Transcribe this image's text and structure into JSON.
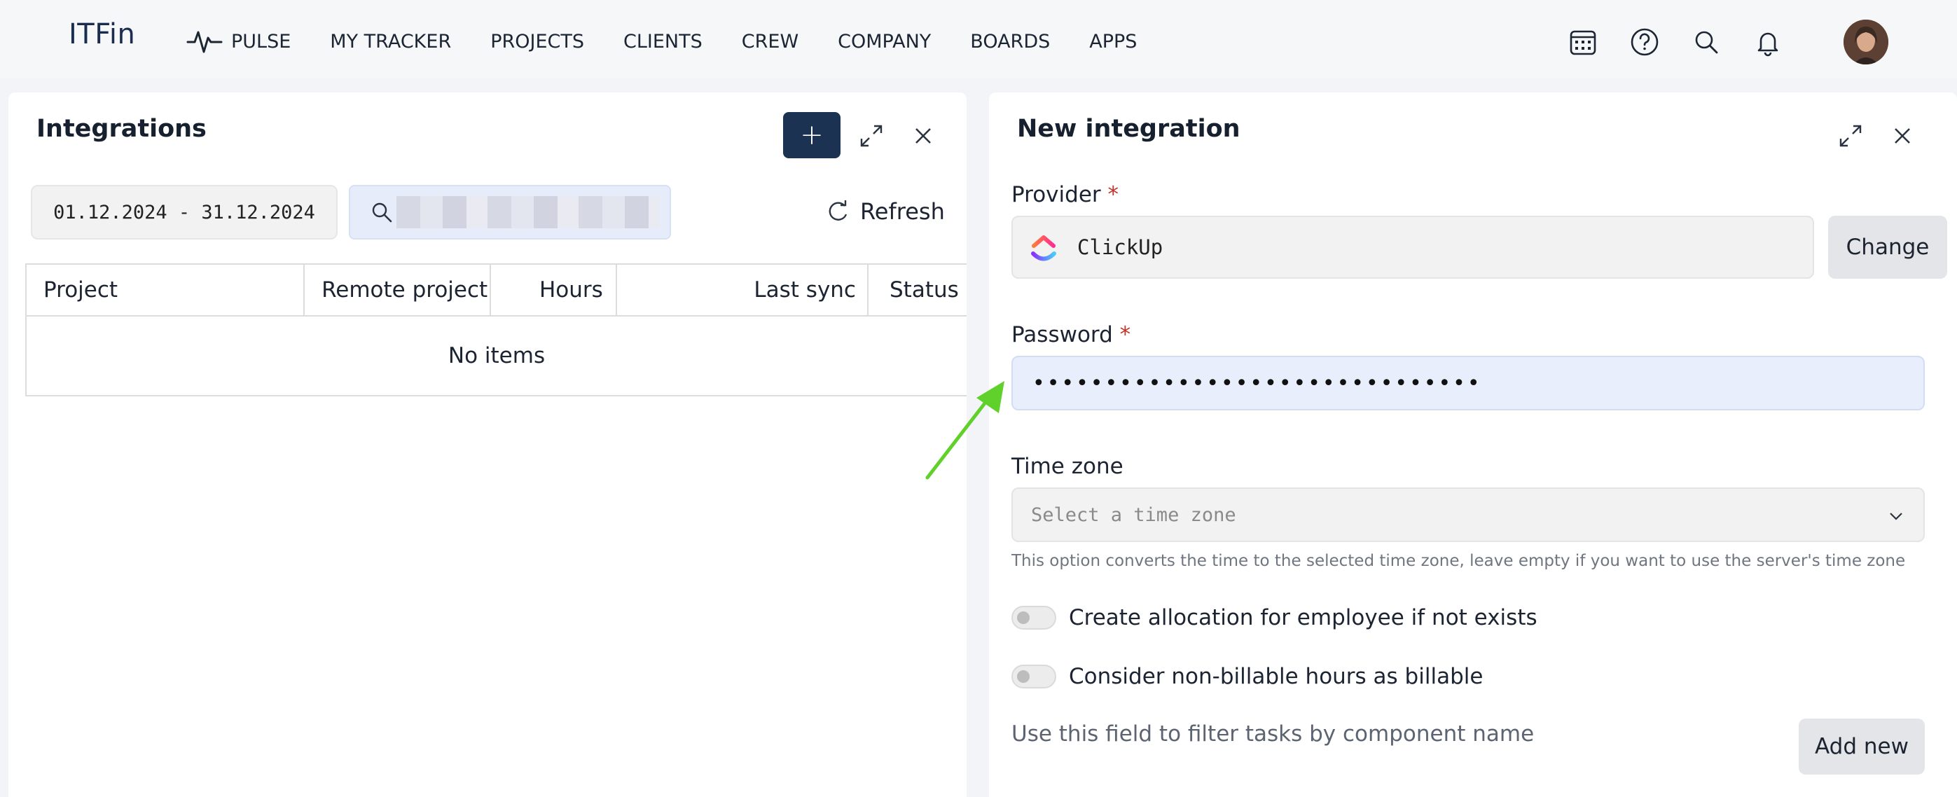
{
  "brand": {
    "logo": "ITFin"
  },
  "nav": {
    "items": [
      "PULSE",
      "MY TRACKER",
      "PROJECTS",
      "CLIENTS",
      "CREW",
      "COMPANY",
      "BOARDS",
      "APPS"
    ],
    "icons": [
      "calendar-icon",
      "help-icon",
      "search-icon",
      "bell-icon"
    ]
  },
  "integrations": {
    "title": "Integrations",
    "add_label": "+",
    "date_range": "01.12.2024 - 31.12.2024",
    "refresh_label": "Refresh",
    "columns": [
      "Project",
      "Remote project",
      "Hours",
      "Last sync",
      "Status"
    ],
    "empty_text": "No items"
  },
  "new_integration": {
    "title": "New integration",
    "provider_label": "Provider",
    "provider_value": "ClickUp",
    "change_label": "Change",
    "password_label": "Password",
    "password_value": "•••••••••••••••••••••••••••••••",
    "timezone_label": "Time zone",
    "timezone_placeholder": "Select a time zone",
    "timezone_hint": "This option converts the time to the selected time zone, leave empty if you want to use the server's time zone",
    "toggle_allocation": "Create allocation for employee if not exists",
    "toggle_nonbillable": "Consider non-billable hours as billable",
    "filter_text": "Use this field to filter tasks by component name",
    "add_new_label": "Add new",
    "required_mark": "*"
  },
  "colors": {
    "accent": "#1b3252",
    "required": "#c0352b",
    "arrow": "#5fd12a"
  }
}
